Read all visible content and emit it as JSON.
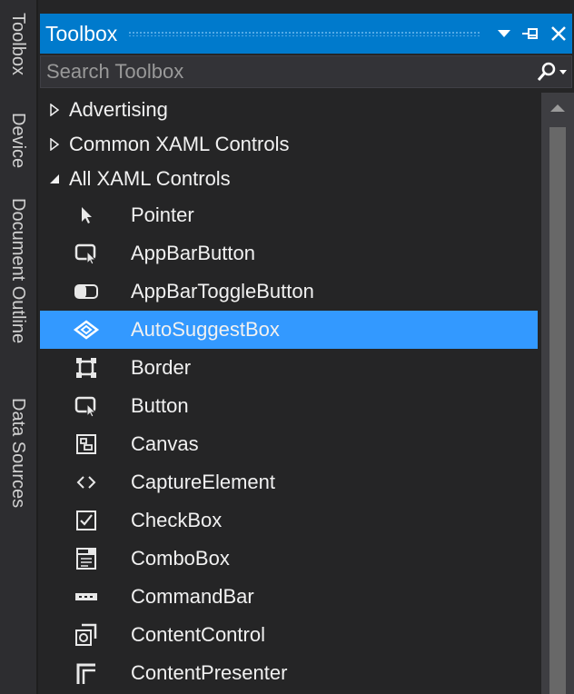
{
  "side_tabs": [
    "Toolbox",
    "Device",
    "Document Outline",
    "Data Sources"
  ],
  "panel": {
    "title": "Toolbox",
    "buttons": [
      "dropdown-icon",
      "pin-icon",
      "close-icon"
    ]
  },
  "search": {
    "placeholder": "Search Toolbox",
    "value": ""
  },
  "categories": [
    {
      "label": "Advertising",
      "expanded": false
    },
    {
      "label": "Common XAML Controls",
      "expanded": false
    },
    {
      "label": "All XAML Controls",
      "expanded": true
    }
  ],
  "items": [
    {
      "label": "Pointer",
      "icon": "pointer-icon"
    },
    {
      "label": "AppBarButton",
      "icon": "appbarbutton-icon"
    },
    {
      "label": "AppBarToggleButton",
      "icon": "toggle-icon"
    },
    {
      "label": "AutoSuggestBox",
      "icon": "autosuggest-icon",
      "selected": true
    },
    {
      "label": "Border",
      "icon": "border-icon"
    },
    {
      "label": "Button",
      "icon": "button-icon"
    },
    {
      "label": "Canvas",
      "icon": "canvas-icon"
    },
    {
      "label": "CaptureElement",
      "icon": "capture-icon"
    },
    {
      "label": "CheckBox",
      "icon": "checkbox-icon"
    },
    {
      "label": "ComboBox",
      "icon": "combobox-icon"
    },
    {
      "label": "CommandBar",
      "icon": "commandbar-icon"
    },
    {
      "label": "ContentControl",
      "icon": "contentcontrol-icon"
    },
    {
      "label": "ContentPresenter",
      "icon": "contentpresenter-icon"
    }
  ],
  "colors": {
    "accent": "#007acc",
    "selection": "#3399ff",
    "panel_bg": "#252526"
  }
}
